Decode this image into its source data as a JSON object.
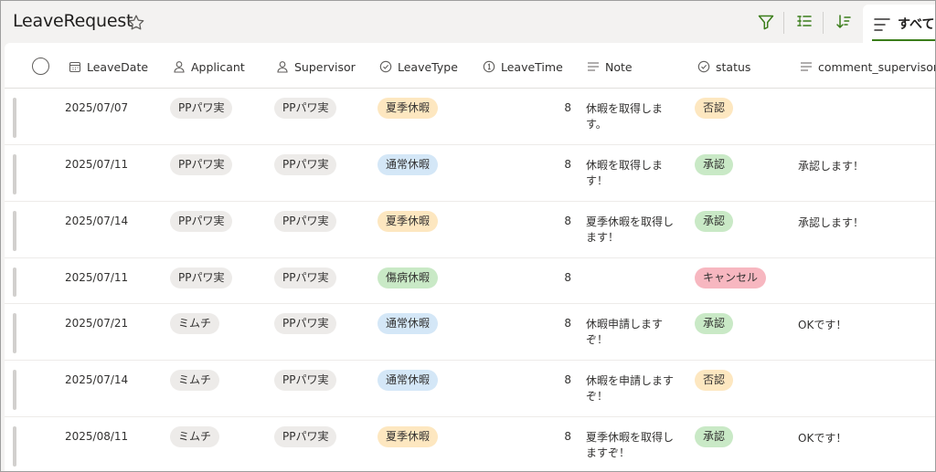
{
  "app": {
    "title": "LeaveRequest"
  },
  "toolbar": {
    "view_label": "すべて"
  },
  "columns": [
    {
      "key": "leave_date",
      "label": "LeaveDate",
      "icon": "calendar-icon"
    },
    {
      "key": "applicant",
      "label": "Applicant",
      "icon": "person-icon"
    },
    {
      "key": "supervisor",
      "label": "Supervisor",
      "icon": "person-icon"
    },
    {
      "key": "leave_type",
      "label": "LeaveType",
      "icon": "choice-check-icon"
    },
    {
      "key": "leave_time",
      "label": "LeaveTime",
      "icon": "number-icon"
    },
    {
      "key": "note",
      "label": "Note",
      "icon": "text-lines-icon"
    },
    {
      "key": "status",
      "label": "status",
      "icon": "choice-check-icon"
    },
    {
      "key": "comment_supervisor",
      "label": "comment_supervisor",
      "icon": "text-lines-icon"
    }
  ],
  "colors": {
    "summer": "#fde7c0",
    "normal": "#d4e7f7",
    "sick": "#c9e9c6",
    "approved": "#c9e9c6",
    "rejected": "#fde7c0",
    "cancel": "#f7b7c0",
    "accent": "#3a7d1a"
  },
  "rows": [
    {
      "leave_date": "2025/07/07",
      "applicant": "PPパワ実",
      "supervisor": "PPパワ実",
      "leave_type": "夏季休暇",
      "leave_type_color": "summer",
      "leave_time": "8",
      "note": "休暇を取得します。",
      "status": "否認",
      "status_color": "rejected",
      "comment": ""
    },
    {
      "leave_date": "2025/07/11",
      "applicant": "PPパワ実",
      "supervisor": "PPパワ実",
      "leave_type": "通常休暇",
      "leave_type_color": "normal",
      "leave_time": "8",
      "note": "休暇を取得します！",
      "status": "承認",
      "status_color": "approved",
      "comment": "承認します！"
    },
    {
      "leave_date": "2025/07/14",
      "applicant": "PPパワ実",
      "supervisor": "PPパワ実",
      "leave_type": "夏季休暇",
      "leave_type_color": "summer",
      "leave_time": "8",
      "note": "夏季休暇を取得します！",
      "status": "承認",
      "status_color": "approved",
      "comment": "承認します！"
    },
    {
      "leave_date": "2025/07/11",
      "applicant": "PPパワ実",
      "supervisor": "PPパワ実",
      "leave_type": "傷病休暇",
      "leave_type_color": "sick",
      "leave_time": "8",
      "note": "",
      "status": "キャンセル",
      "status_color": "cancel",
      "comment": ""
    },
    {
      "leave_date": "2025/07/21",
      "applicant": "ミムチ",
      "supervisor": "PPパワ実",
      "leave_type": "通常休暇",
      "leave_type_color": "normal",
      "leave_time": "8",
      "note": "休暇申請しますぞ！",
      "status": "承認",
      "status_color": "approved",
      "comment": "OKです！"
    },
    {
      "leave_date": "2025/07/14",
      "applicant": "ミムチ",
      "supervisor": "PPパワ実",
      "leave_type": "通常休暇",
      "leave_type_color": "normal",
      "leave_time": "8",
      "note": "休暇を申請しますぞ！",
      "status": "否認",
      "status_color": "rejected",
      "comment": ""
    },
    {
      "leave_date": "2025/08/11",
      "applicant": "ミムチ",
      "supervisor": "PPパワ実",
      "leave_type": "夏季休暇",
      "leave_type_color": "summer",
      "leave_time": "8",
      "note": "夏季休暇を取得しますぞ！",
      "status": "承認",
      "status_color": "approved",
      "comment": "OKです！"
    }
  ]
}
